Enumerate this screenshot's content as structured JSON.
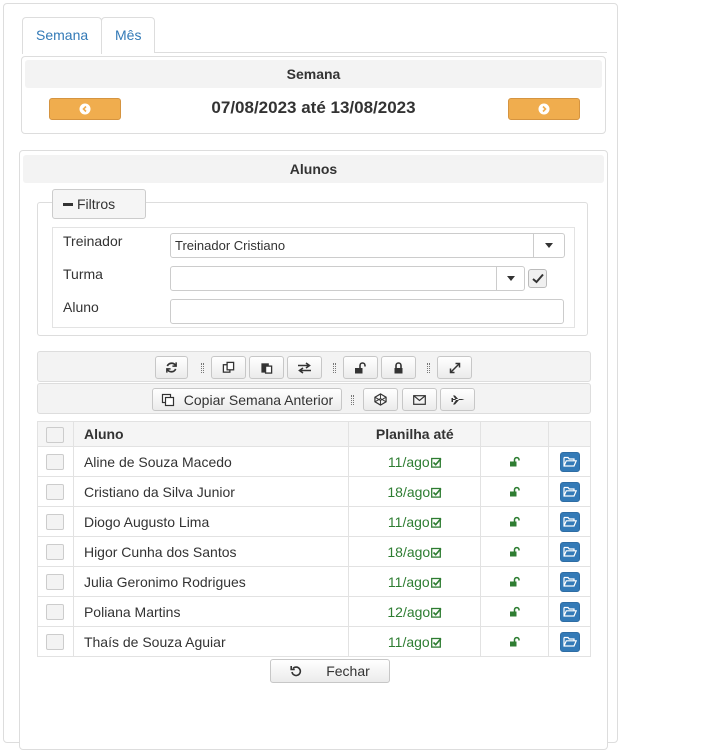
{
  "tabs": [
    {
      "label": "Semana"
    },
    {
      "label": "Mês"
    }
  ],
  "week": {
    "title": "Semana",
    "range": "07/08/2023 até 13/08/2023"
  },
  "alunos": {
    "title": "Alunos",
    "filters_label": "Filtros",
    "trainer_label": "Treinador",
    "trainer_value": "Treinador Cristiano",
    "turma_label": "Turma",
    "turma_value": "",
    "aluno_label": "Aluno",
    "aluno_value": "",
    "copy_label": "Copiar Semana Anterior",
    "close_label": "Fechar"
  },
  "table": {
    "headers": {
      "name": "Aluno",
      "until": "Planilha até"
    },
    "rows": [
      {
        "name": "Aline de Souza Macedo",
        "until": "11/ago"
      },
      {
        "name": "Cristiano da Silva Junior",
        "until": "18/ago"
      },
      {
        "name": "Diogo Augusto Lima",
        "until": "11/ago"
      },
      {
        "name": "Higor Cunha dos Santos",
        "until": "18/ago"
      },
      {
        "name": "Julia Geronimo Rodrigues",
        "until": "11/ago"
      },
      {
        "name": "Poliana Martins",
        "until": "12/ago"
      },
      {
        "name": "Thaís de Souza Aguiar",
        "until": "11/ago"
      }
    ]
  },
  "colors": {
    "accent": "#337ab7",
    "orange": "#f0ad4e",
    "green": "#2e7d32"
  }
}
